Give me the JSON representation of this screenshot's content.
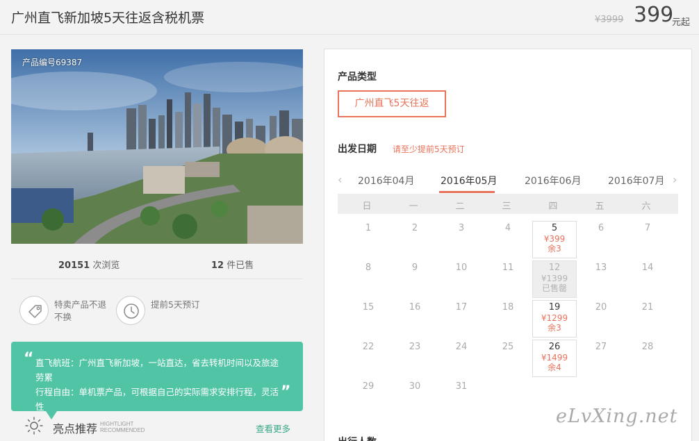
{
  "header": {
    "title": "广州直飞新加坡5天往返含税机票",
    "original_price": "¥3999",
    "price": "399",
    "price_unit": "元起"
  },
  "photo": {
    "product_no": "产品编号69387"
  },
  "stats": {
    "views_count": "20151",
    "views_label": "次浏览",
    "sold_count": "12",
    "sold_label": "件已售"
  },
  "features": [
    {
      "icon": "tag-icon",
      "text": "特卖产品不退不换"
    },
    {
      "icon": "clock-icon",
      "text": "提前5天预订"
    }
  ],
  "highlight": {
    "lines": [
      "直飞航班：广州直飞新加坡，一站直达，省去转机时间以及旅途劳累",
      "行程自由：单机票产品，可根据自己的实际需求安排行程，灵活性"
    ],
    "title": "亮点推荐",
    "title_en_1": "HIGHTLIGHT",
    "title_en_2": "RECOMMENDED",
    "more": "查看更多"
  },
  "panel": {
    "type_label": "产品类型",
    "type_option": "广州直飞5天往返",
    "date_label": "出发日期",
    "date_note": "请至少提前5天预订",
    "months": [
      "2016年04月",
      "2016年05月",
      "2016年06月",
      "2016年07月"
    ],
    "active_month": "2016年05月",
    "weekdays": [
      "日",
      "一",
      "二",
      "三",
      "四",
      "五",
      "六"
    ],
    "travelers_label": "出行人数"
  },
  "calendar": {
    "days": [
      "1",
      "2",
      "3",
      "4",
      "5",
      "6",
      "7",
      "8",
      "9",
      "10",
      "11",
      "12",
      "13",
      "14",
      "15",
      "16",
      "17",
      "18",
      "19",
      "20",
      "21",
      "22",
      "23",
      "24",
      "25",
      "26",
      "27",
      "28",
      "29",
      "30",
      "31"
    ],
    "available": [
      {
        "day": "5",
        "price": "¥399",
        "status": "余3"
      },
      {
        "day": "12",
        "price": "¥1399",
        "status": "已售罄"
      },
      {
        "day": "19",
        "price": "¥1299",
        "status": "余3"
      },
      {
        "day": "26",
        "price": "¥1499",
        "status": "余4"
      }
    ]
  },
  "watermark": "eLvXing.net",
  "colors": {
    "accent": "#e8725a",
    "highlight_bg": "#52c4a6",
    "more_link": "#3aa888"
  }
}
